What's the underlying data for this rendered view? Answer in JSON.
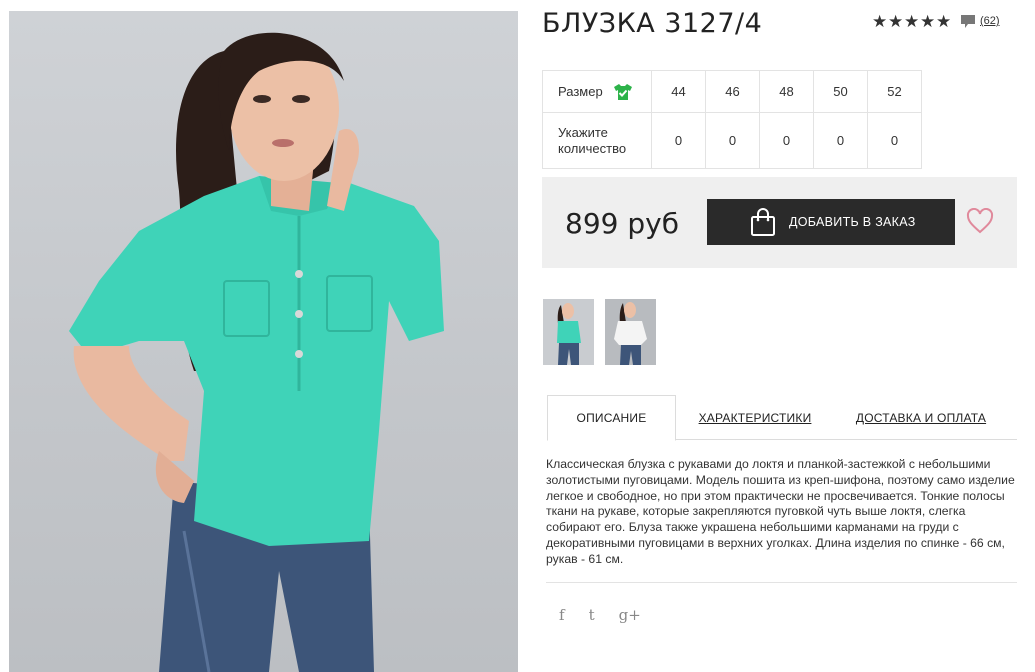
{
  "product": {
    "title": "БЛУЗКА 3127/4",
    "rating_stars": 5,
    "reviews_count": "(62)",
    "star_glyph": "★"
  },
  "sizes": {
    "size_label": "Размер",
    "qty_label": "Укажите количество",
    "values": [
      "44",
      "46",
      "48",
      "50",
      "52"
    ],
    "quantities": [
      "0",
      "0",
      "0",
      "0",
      "0"
    ]
  },
  "buy": {
    "price": "899 руб",
    "add_button_label": "ДОБАВИТЬ В ЗАКАЗ"
  },
  "tabs": [
    {
      "label": "ОПИСАНИЕ",
      "active": true
    },
    {
      "label": "ХАРАКТЕРИСТИКИ",
      "active": false
    },
    {
      "label": "ДОСТАВКА И ОПЛАТА",
      "active": false
    }
  ],
  "description": "Классическая блузка с рукавами до локтя и планкой-застежкой с небольшими золотистыми пуговицами. Модель пошита из креп-шифона, поэтому само изделие легкое и свободное, но при этом практически не просвечивается. Тонкие полосы ткани на рукаве, которые закрепляются пуговкой чуть выше локтя, слегка собирают его. Блуза также украшена небольшими карманами на груди с декоративными пуговицами в верхних уголках. Длина изделия по спинке - 66 см, рукав - 61 см.",
  "social": {
    "facebook": "f",
    "twitter": "t",
    "google": "g+"
  },
  "icons": {
    "size_guide": "tshirt-check-icon",
    "comment": "speech-bubble-icon",
    "bag": "shopping-bag-icon",
    "favorite": "heart-icon"
  },
  "colors": {
    "accent_green": "#2db34a",
    "button_dark": "#2a2a2a",
    "heart": "#e0899b",
    "blouse": "#3fd3b8"
  }
}
